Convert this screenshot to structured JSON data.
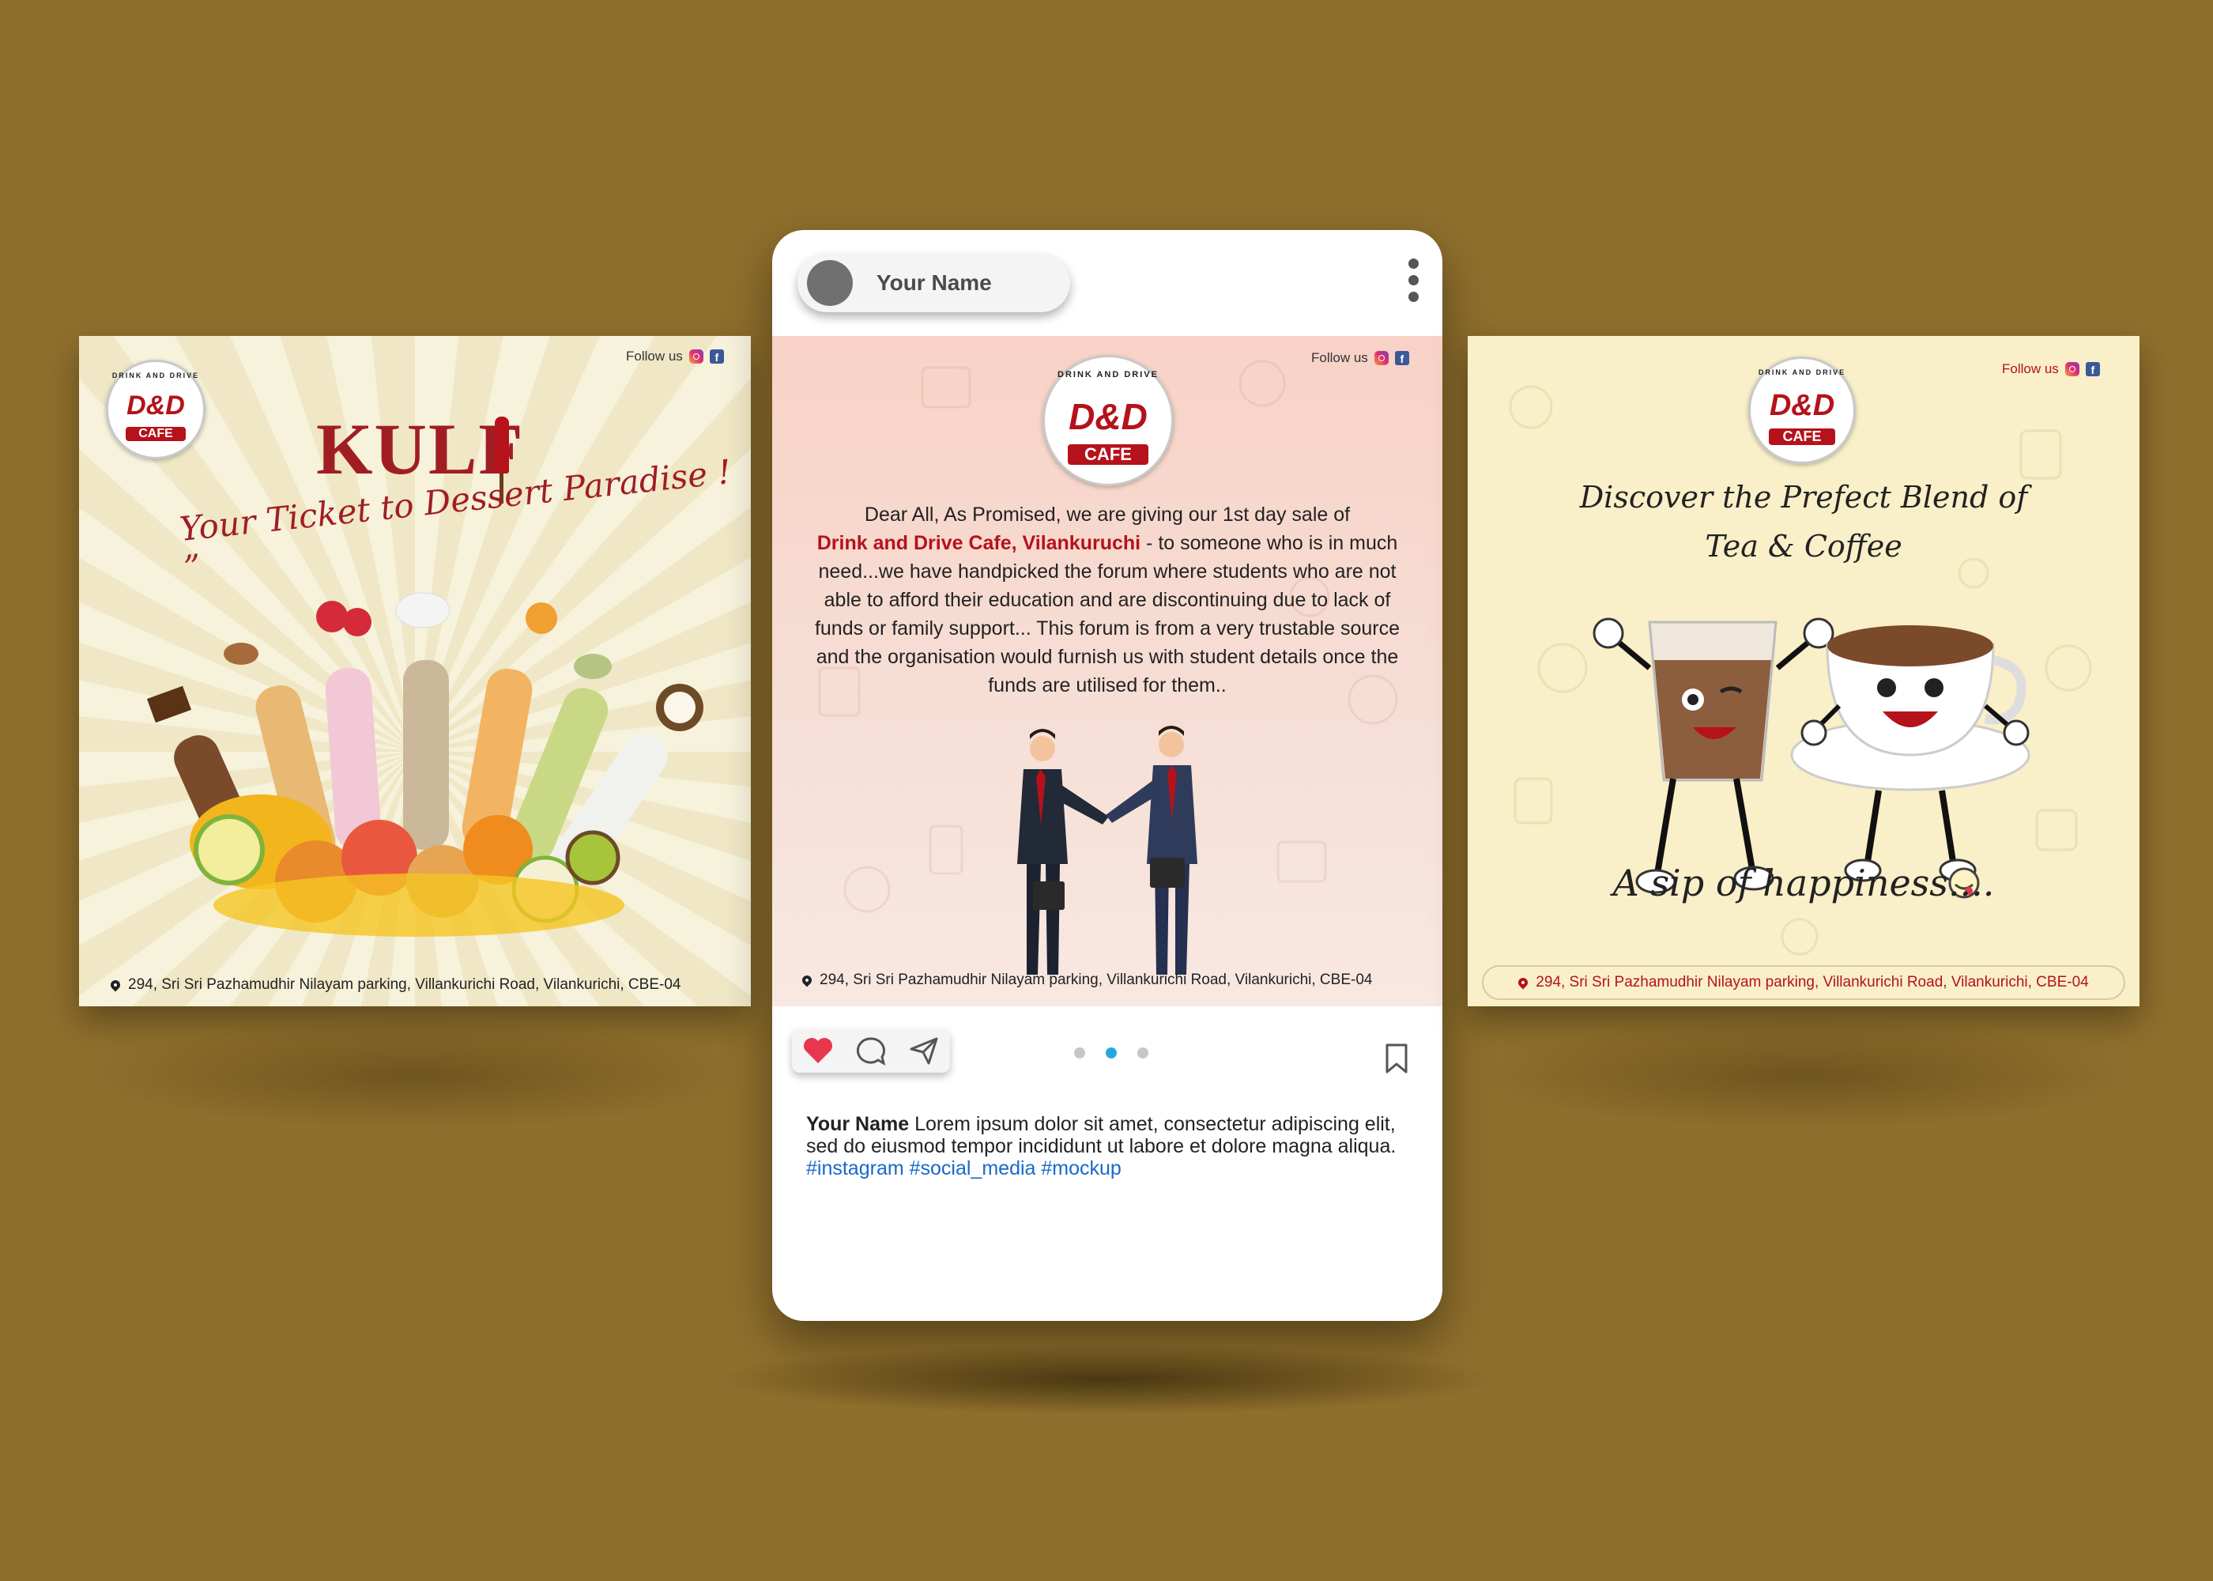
{
  "colors": {
    "background": "#8f6f2c",
    "brand_red": "#b5121b",
    "hashtag_blue": "#1769c9",
    "dot_active": "#27a7df"
  },
  "left_post": {
    "follow_label": "Follow us",
    "logo": {
      "arc_text": "DRINK AND DRIVE",
      "mark": "D&D",
      "cafe": "CAFE"
    },
    "title": "KULF",
    "tagline": "Your Ticket to Dessert Paradise ! ”",
    "address": "294, Sri Sri Pazhamudhir Nilayam parking, Villankurichi Road, Vilankurichi, CBE-04"
  },
  "phone": {
    "username": "Your Name",
    "center_post": {
      "follow_label": "Follow us",
      "logo": {
        "arc_text": "DRINK AND DRIVE",
        "mark": "D&D",
        "cafe": "CAFE"
      },
      "body_1": "Dear All, As Promised, we are giving our 1st day sale of",
      "body_highlight": "Drink and Drive Cafe, Vilankuruchi",
      "body_2": " - to someone who is in much need...we have handpicked the forum where students who are not able  to afford their education and are discontinuing due to lack of funds or family support... This forum is from a very trustable source and the organisation would furnish us with student details once the funds are utilised for them..",
      "address": "294, Sri Sri Pazhamudhir Nilayam parking, Villankurichi Road, Vilankurichi, CBE-04"
    },
    "carousel": {
      "count": 3,
      "active_index": 1
    },
    "caption": {
      "name": "Your Name",
      "text": " Lorem ipsum dolor sit amet, consectetur adipiscing elit, sed do eiusmod tempor incididunt ut labore et dolore magna aliqua. ",
      "tags": "#instagram #social_media #mockup"
    }
  },
  "right_post": {
    "follow_label": "Follow us",
    "logo": {
      "arc_text": "DRINK AND DRIVE",
      "mark": "D&D",
      "cafe": "CAFE"
    },
    "heading_1": "Discover the Prefect Blend of",
    "heading_2": "Tea & Coffee",
    "slogan": "A sip of happiness....",
    "address": "294, Sri Sri Pazhamudhir Nilayam parking, Villankurichi Road, Vilankurichi, CBE-04"
  }
}
